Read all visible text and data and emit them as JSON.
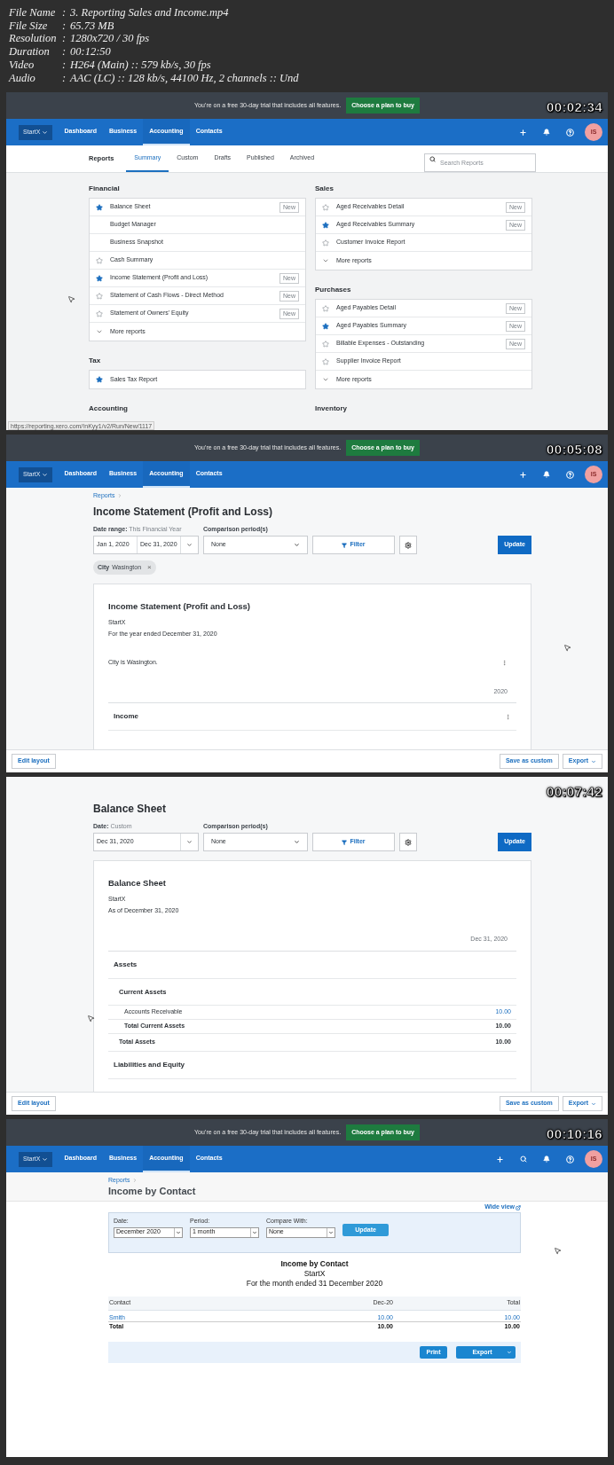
{
  "file_info": [
    {
      "label": "File Name",
      "sep": ":",
      "value": "3. Reporting Sales and Income.mp4"
    },
    {
      "label": "File Size",
      "sep": ":",
      "value": "65.73 MB"
    },
    {
      "label": "Resolution",
      "sep": ":",
      "value": "1280x720 / 30 fps"
    },
    {
      "label": "Duration",
      "sep": ":",
      "value": "00:12:50"
    },
    {
      "label": "Video",
      "sep": ":",
      "value": "H264 (Main) :: 579 kb/s, 30 fps"
    },
    {
      "label": "Audio",
      "sep": ":",
      "value": "AAC (LC) :: 128 kb/s, 44100 Hz, 2 channels :: Und"
    }
  ],
  "frames": [
    {
      "kind": "reports_summary",
      "timestamp": "00:02:34",
      "banner": {
        "text": "You’re on a free 30-day trial that includes all features.",
        "button": "Choose a plan to buy"
      },
      "nav": {
        "org": "StartX",
        "items": [
          {
            "label": "Dashboard",
            "selected": false
          },
          {
            "label": "Business",
            "selected": false
          },
          {
            "label": "Accounting",
            "selected": true
          },
          {
            "label": "Contacts",
            "selected": false
          }
        ],
        "search_icon": false,
        "avatar": "IS"
      },
      "subnav": {
        "title": "Reports",
        "tabs": [
          {
            "label": "Summary",
            "selected": true
          },
          {
            "label": "Custom",
            "selected": false
          },
          {
            "label": "Drafts",
            "selected": false
          },
          {
            "label": "Published",
            "selected": false
          },
          {
            "label": "Archived",
            "selected": false
          }
        ],
        "search_placeholder": "Search Reports"
      },
      "columns": [
        [
          {
            "heading": "Financial",
            "items": [
              {
                "kind": "report",
                "label": "Balance Sheet",
                "starred": true,
                "badge": "New"
              },
              {
                "kind": "report",
                "label": "Budget Manager"
              },
              {
                "kind": "report",
                "label": "Business Snapshot"
              },
              {
                "kind": "report",
                "label": "Cash Summary",
                "starred": false
              },
              {
                "kind": "report",
                "label": "Income Statement (Profit and Loss)",
                "starred": true,
                "badge": "New"
              },
              {
                "kind": "report",
                "label": "Statement of Cash Flows - Direct Method",
                "starred": false,
                "badge": "New"
              },
              {
                "kind": "report",
                "label": "Statement of Owners' Equity",
                "starred": false,
                "badge": "New"
              },
              {
                "kind": "more",
                "label": "More reports"
              }
            ]
          },
          {
            "heading": "Tax",
            "items": [
              {
                "kind": "report",
                "label": "Sales Tax Report",
                "starred": true
              }
            ]
          },
          {
            "heading": "Accounting"
          }
        ],
        [
          {
            "heading": "Sales",
            "items": [
              {
                "kind": "report",
                "label": "Aged Receivables Detail",
                "starred": false,
                "badge": "New"
              },
              {
                "kind": "report",
                "label": "Aged Receivables Summary",
                "starred": true,
                "badge": "New"
              },
              {
                "kind": "report",
                "label": "Customer Invoice Report",
                "starred": false
              },
              {
                "kind": "more",
                "label": "More reports"
              }
            ]
          },
          {
            "heading": "Purchases",
            "items": [
              {
                "kind": "report",
                "label": "Aged Payables Detail",
                "starred": false,
                "badge": "New"
              },
              {
                "kind": "report",
                "label": "Aged Payables Summary",
                "starred": true,
                "badge": "New"
              },
              {
                "kind": "report",
                "label": "Billable Expenses - Outstanding",
                "starred": false,
                "badge": "New"
              },
              {
                "kind": "report",
                "label": "Supplier Invoice Report",
                "starred": false
              },
              {
                "kind": "more",
                "label": "More reports"
              }
            ]
          },
          {
            "heading": "Inventory"
          }
        ]
      ],
      "status_url": "https://reporting.xero.com/!nKyy1/v2/Run/New/1117"
    },
    {
      "kind": "report_view",
      "timestamp": "00:05:08",
      "banner": {
        "text": "You’re on a free 30-day trial that includes all features.",
        "button": "Choose a plan to buy"
      },
      "nav": {
        "org": "StartX",
        "items": [
          {
            "label": "Dashboard",
            "selected": false
          },
          {
            "label": "Business",
            "selected": false
          },
          {
            "label": "Accounting",
            "selected": true
          },
          {
            "label": "Contacts",
            "selected": false
          }
        ],
        "search_icon": false,
        "avatar": "IS"
      },
      "breadcrumb": "Reports",
      "title": "Income Statement (Profit and Loss)",
      "date": {
        "label": "Date range:",
        "value": "This Financial Year",
        "fields": [
          "Jan 1, 2020",
          "Dec 31, 2020"
        ]
      },
      "comparison": {
        "label": "Comparison period(s)",
        "value": "None"
      },
      "filter_button": "Filter",
      "update_button": "Update",
      "chips": [
        {
          "key": "City",
          "value": "Wasington",
          "remove": "×"
        }
      ],
      "report": {
        "title": "Income Statement (Profit and Loss)",
        "lines": [
          "StartX",
          "For the year ended December 31, 2020"
        ],
        "note": "City is Wasington.",
        "column": "2020",
        "sections": [
          {
            "kind": "heading",
            "label": "Income",
            "menu": true
          }
        ]
      },
      "footer": {
        "left": "Edit layout",
        "right": [
          "Save as custom",
          "Export"
        ]
      }
    },
    {
      "kind": "report_view",
      "timestamp": "00:07:42",
      "title": "Balance Sheet",
      "date": {
        "label": "Date:",
        "value": "Custom",
        "fields": [
          "Dec 31, 2020"
        ]
      },
      "comparison": {
        "label": "Comparison period(s)",
        "value": "None"
      },
      "filter_button": "Filter",
      "update_button": "Update",
      "report": {
        "title": "Balance Sheet",
        "lines": [
          "StartX",
          "As of December 31, 2020"
        ],
        "column": "Dec 31, 2020",
        "sections": [
          {
            "kind": "heading",
            "label": "Assets",
            "menu": false
          },
          {
            "kind": "subheading",
            "label": "Current Assets"
          },
          {
            "kind": "row",
            "label": "Accounts Receivable",
            "value": "10.00"
          },
          {
            "kind": "subtotal",
            "label": "Total Current Assets",
            "value": "10.00"
          },
          {
            "kind": "total",
            "label": "Total Assets",
            "value": "10.00"
          },
          {
            "kind": "heading",
            "label": "Liabilities and Equity",
            "menu": false
          }
        ]
      },
      "footer": {
        "left": "Edit layout",
        "right": [
          "Save as custom",
          "Export"
        ]
      }
    },
    {
      "kind": "legacy_report",
      "timestamp": "00:10:16",
      "banner": {
        "text": "You’re on a free 30-day trial that includes all features.",
        "button": "Choose a plan to buy"
      },
      "nav": {
        "org": "StartX",
        "items": [
          {
            "label": "Dashboard",
            "selected": false
          },
          {
            "label": "Business",
            "selected": false
          },
          {
            "label": "Accounting",
            "selected": true
          },
          {
            "label": "Contacts",
            "selected": false
          }
        ],
        "search_icon": true,
        "avatar": "IS"
      },
      "breadcrumb": "Reports",
      "title": "Income by Contact",
      "wide_view": "Wide view",
      "form": [
        {
          "label": "Date:",
          "value": "December 2020"
        },
        {
          "label": "Period:",
          "value": "1 month"
        },
        {
          "label": "Compare With:",
          "value": "None"
        }
      ],
      "update_button": "Update",
      "report": {
        "title": "Income by Contact",
        "lines": [
          "StartX",
          "For the month ended 31 December 2020"
        ]
      },
      "table": {
        "columns": [
          "Contact",
          "Dec-20",
          "Total"
        ],
        "rows": [
          {
            "kind": "link",
            "cells": [
              "Smith",
              "10.00",
              "10.00"
            ]
          },
          {
            "kind": "total",
            "cells": [
              "Total",
              "10.00",
              "10.00"
            ]
          }
        ]
      },
      "buttons": [
        "Print",
        "Export"
      ]
    }
  ]
}
